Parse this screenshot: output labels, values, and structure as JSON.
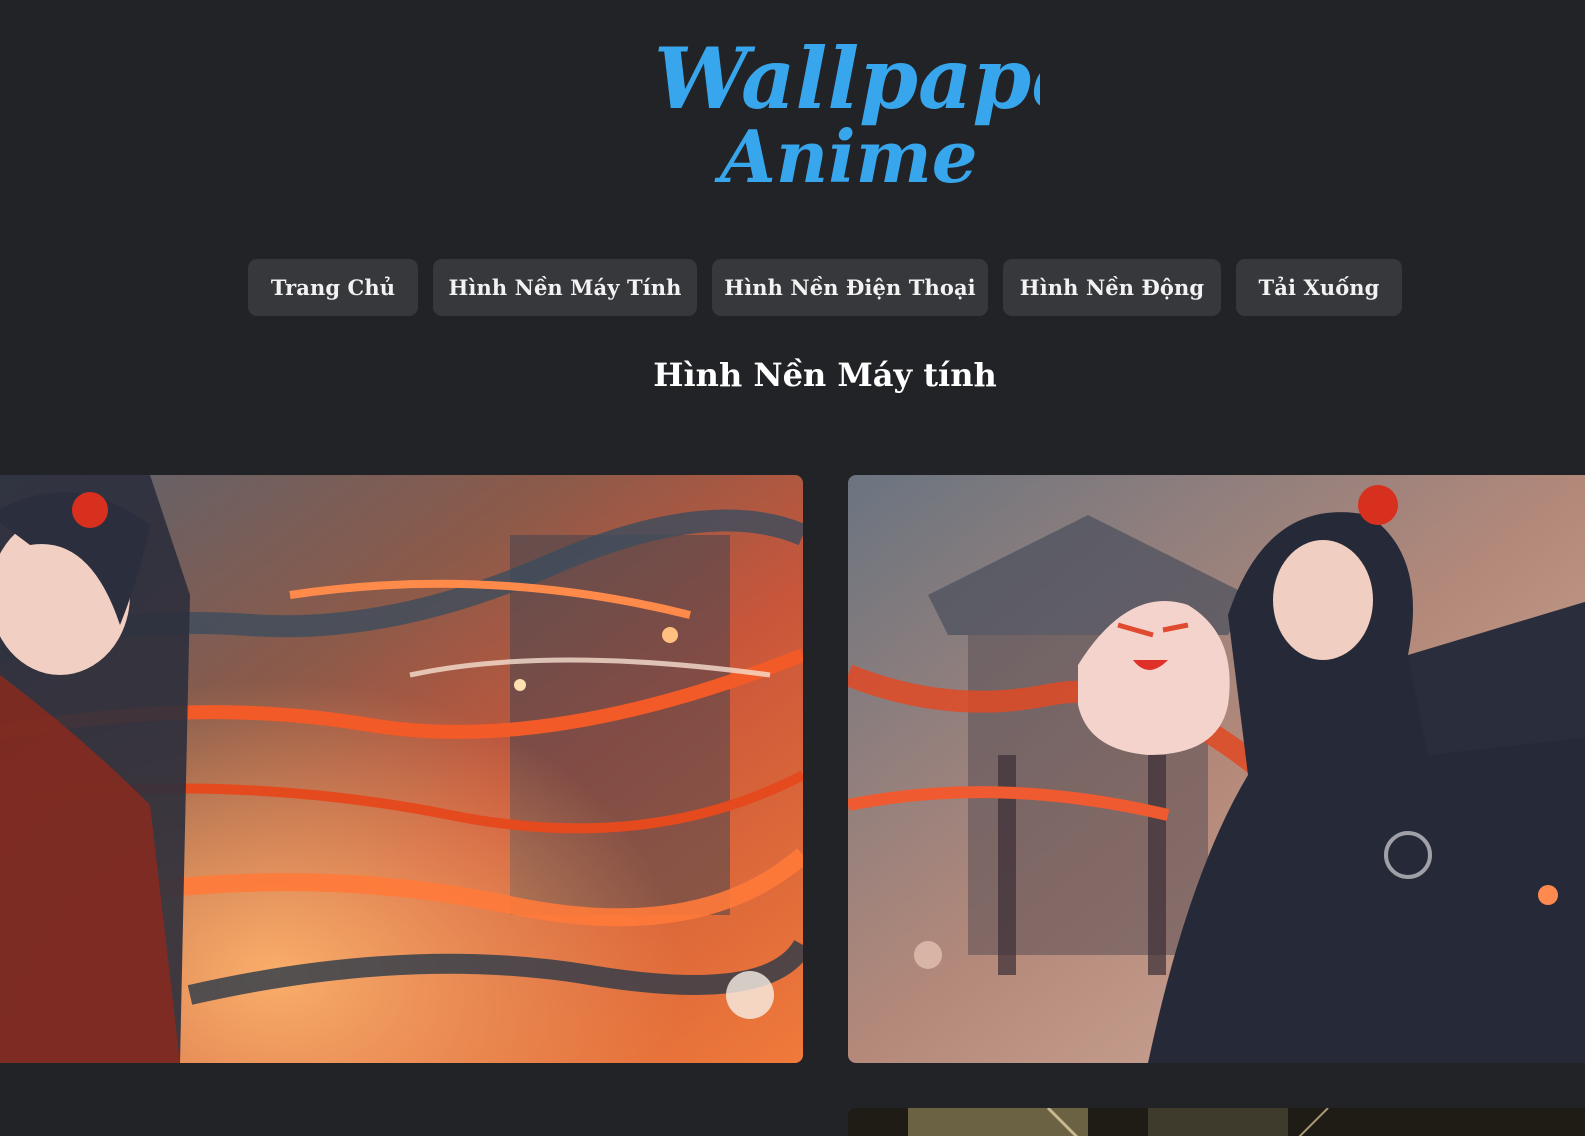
{
  "logo": {
    "line1": "Wallpaper",
    "line2": "Anime",
    "color": "#38a6ec"
  },
  "nav": {
    "items": [
      {
        "label": "Trang Chủ"
      },
      {
        "label": "Hình Nền Máy Tính"
      },
      {
        "label": "Hình Nền Điện Thoại"
      },
      {
        "label": "Hình Nền Động"
      },
      {
        "label": "Tải Xuống"
      }
    ]
  },
  "main": {
    "section_title": "Hình Nền Máy tính"
  },
  "colors": {
    "background": "#222326",
    "button_bg": "#37383c",
    "accent": "#38a6ec"
  }
}
